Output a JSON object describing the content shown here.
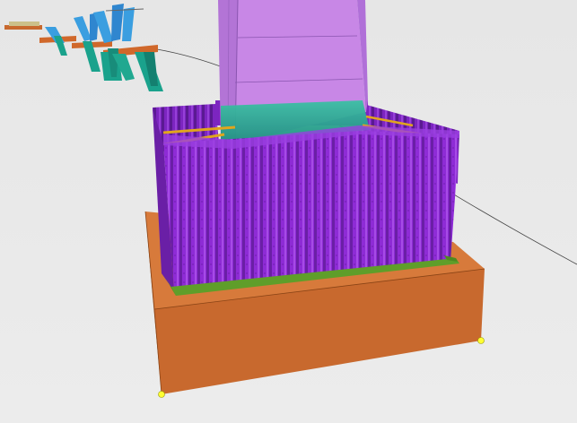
{
  "viewport": {
    "label": "",
    "background": "#e8e8e8"
  },
  "colors": {
    "pile_cap": "#c8692e",
    "pile_cap_top": "#d77a3b",
    "pile_cap_side": "#b85d26",
    "cofferdam_sheet_piles": "#8e2bd6",
    "cofferdam_dark": "#6a1fa6",
    "pier_column": "#c887e6",
    "pier_mesh": "#33b39a",
    "strut": "#e0a51e",
    "waler": "#5f9e2a",
    "vertex_marker": "#ffff33",
    "bridge_deck": "#d0682b",
    "bridge_pier": "#1aa28c",
    "bridge_pier_top": "#3a9ee0",
    "cable": "#444444"
  },
  "icons": {
    "vertex_marker": "yellow-dot"
  }
}
